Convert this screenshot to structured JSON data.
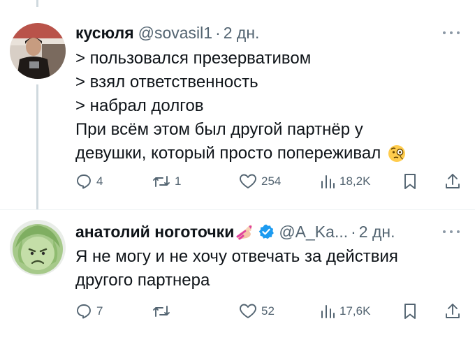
{
  "colors": {
    "text": "#0f1419",
    "secondary": "#536471",
    "divider": "#eff3f4",
    "verified": "#1d9bf0"
  },
  "tweets": [
    {
      "name": "кусюля",
      "handle": "@sovasil1",
      "dot": "·",
      "time": "2 дн.",
      "lines": [
        "> пользовался презервативом",
        "> взял ответственность",
        "> набрал долгов",
        "При всём этом был другой партнёр у",
        "девушки, который просто попереживал"
      ],
      "trailing_emoji": "face-with-monocle",
      "replies": "4",
      "reposts": "1",
      "likes": "254",
      "views": "18,2K"
    },
    {
      "name": "анатолий ноготочки",
      "name_emoji": "nail-polish",
      "verified": true,
      "handle": "@A_Ka...",
      "dot": "·",
      "time": "2 дн.",
      "lines": [
        "Я не могу и не хочу отвечать за действия",
        "другого партнера"
      ],
      "replies": "7",
      "reposts": "",
      "likes": "52",
      "views": "17,6K"
    }
  ]
}
